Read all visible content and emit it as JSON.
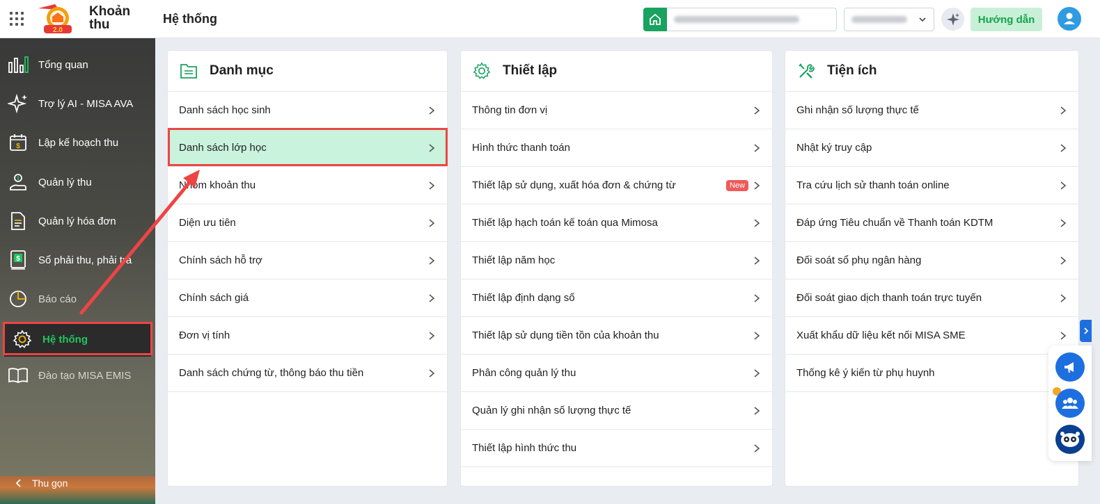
{
  "header": {
    "app_name": "Khoản thu",
    "page_title": "Hệ thống",
    "guide_label": "Hướng dẫn",
    "logo_badge": "2.0"
  },
  "sidebar": {
    "items": [
      {
        "label": "Tổng quan",
        "icon": "bar-chart-icon"
      },
      {
        "label": "Trợ lý AI - MISA AVA",
        "icon": "sparkle-icon"
      },
      {
        "label": "Lập kế hoạch thu",
        "icon": "calendar-money-icon"
      },
      {
        "label": "Quản lý thu",
        "icon": "hand-money-icon"
      },
      {
        "label": "Quản lý hóa đơn",
        "icon": "document-icon"
      },
      {
        "label": "Sổ phải thu, phải trả",
        "icon": "ledger-icon"
      },
      {
        "label": "Báo cáo",
        "icon": "pie-chart-icon"
      },
      {
        "label": "Hệ thống",
        "icon": "gear-icon"
      },
      {
        "label": "Đào tạo MISA EMIS",
        "icon": "book-icon"
      }
    ],
    "collapse_label": "Thu gọn",
    "active_color": "#22c55e"
  },
  "panels": {
    "danh_muc": {
      "title": "Danh mục",
      "items": [
        "Danh sách học sinh",
        "Danh sách lớp học",
        "Nhóm khoản thu",
        "Diện ưu tiên",
        "Chính sách hỗ trợ",
        "Chính sách giá",
        "Đơn vị tính",
        "Danh sách chứng từ, thông báo thu tiền"
      ]
    },
    "thiet_lap": {
      "title": "Thiết lập",
      "items": [
        "Thông tin đơn vị",
        "Hình thức thanh toán",
        "Thiết lập sử dụng, xuất hóa đơn & chứng từ",
        "Thiết lập hạch toán kế toán qua Mimosa",
        "Thiết lập năm học",
        "Thiết lập định dạng số",
        "Thiết lập sử dụng tiền tồn của khoản thu",
        "Phân công quản lý thu",
        "Quản lý ghi nhận số lượng thực tế",
        "Thiết lập hình thức thu"
      ],
      "new_badge": "New"
    },
    "tien_ich": {
      "title": "Tiện ích",
      "items": [
        "Ghi nhận số lượng thực tế",
        "Nhật ký truy cập",
        "Tra cứu lịch sử thanh toán online",
        "Đáp ứng Tiêu chuẩn về Thanh toán KDTM",
        "Đối soát sổ phụ ngân hàng",
        "Đối soát giao dịch thanh toán trực tuyến",
        "Xuất khẩu dữ liệu kết nối MISA SME",
        "Thống kê ý kiến từ phụ huynh"
      ]
    }
  },
  "colors": {
    "brand_green": "#1aa260",
    "highlight_row": "#c9f3dc",
    "annotation_red": "#ef4444",
    "float_blue": "#1d6fe0"
  }
}
